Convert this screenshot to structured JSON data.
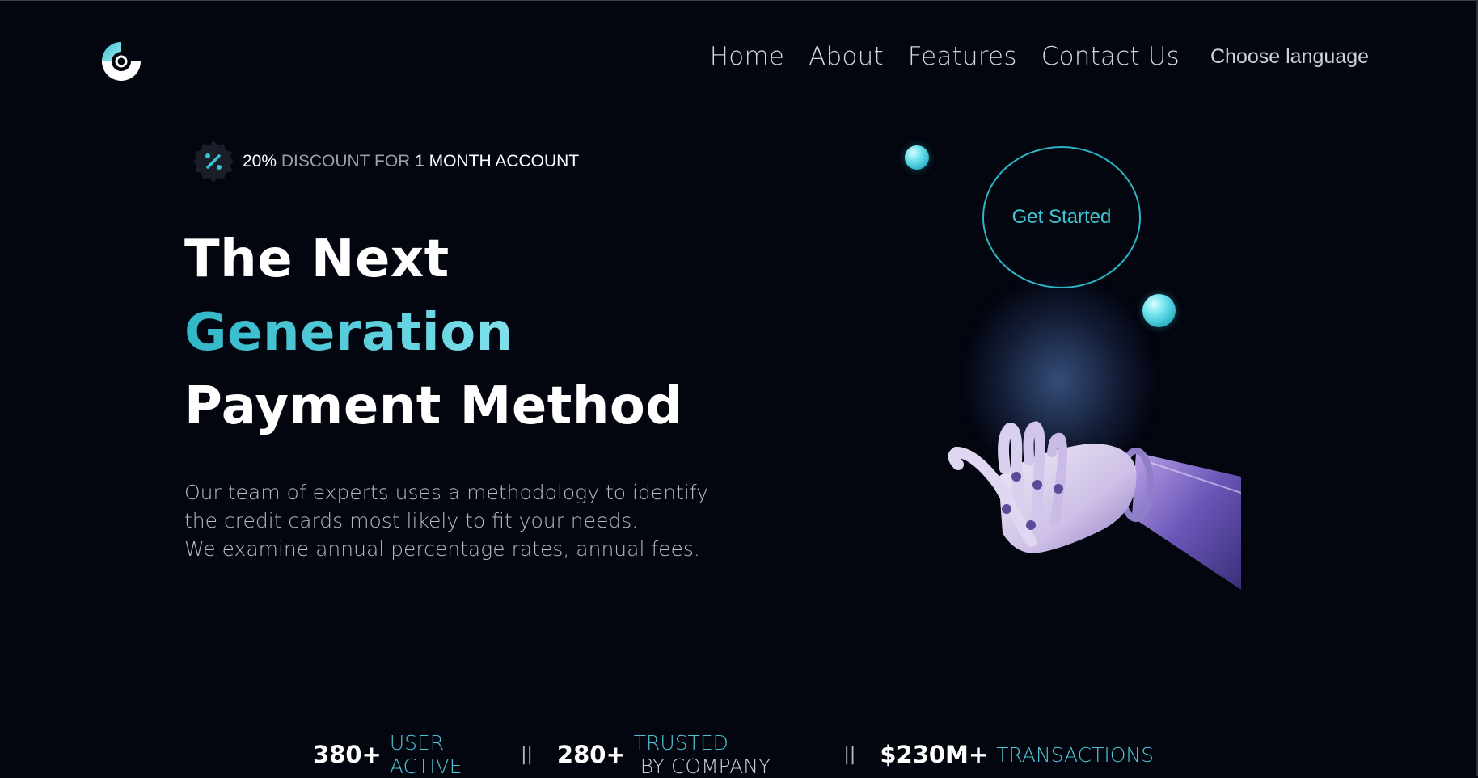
{
  "nav": {
    "items": [
      "Home",
      "About",
      "Features",
      "Contact Us"
    ],
    "language_label": "Choose language"
  },
  "badge": {
    "percent": "20%",
    "text1": " DISCOUNT FOR ",
    "text2": "1 MONTH ACCOUNT",
    "icon": "percent-icon"
  },
  "hero": {
    "line1": "The Next",
    "line2": "Generation",
    "line3": "Payment Method",
    "desc1": "Our team of experts uses a methodology to identify",
    "desc2": "the credit cards most likely to fit your needs.",
    "desc3": "We examine annual percentage rates, annual fees.",
    "cta": "Get Started"
  },
  "stats": [
    {
      "value": "380+",
      "label": "USER ACTIVE",
      "label_tail": ""
    },
    {
      "value": "280+",
      "label": "TRUSTED",
      "label_tail": " BY COMPANY"
    },
    {
      "value": "$230M+",
      "label": "TRANSACTIONS",
      "label_tail": ""
    }
  ],
  "stats_separator": "||",
  "colors": {
    "background": "#03050f",
    "accent": "#2fb7c8",
    "text_muted": "#b6b9c2"
  }
}
